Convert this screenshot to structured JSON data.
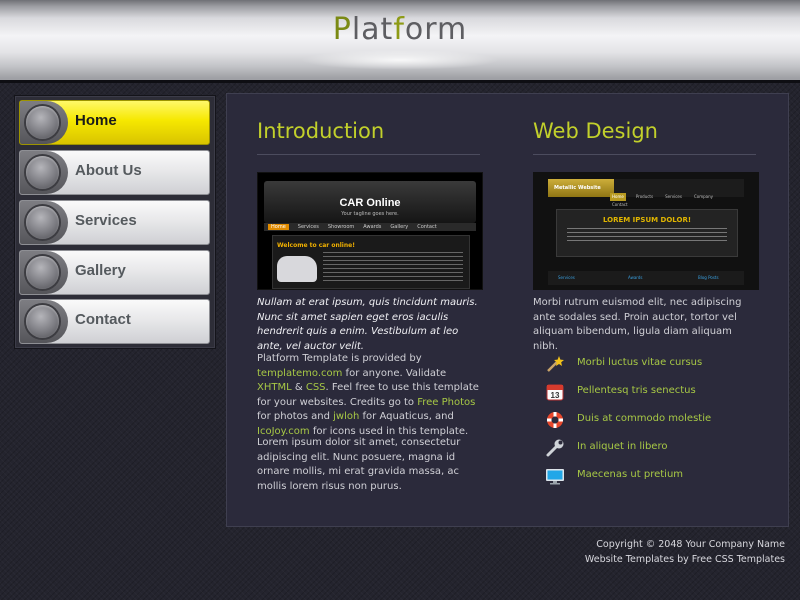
{
  "header": {
    "title_p": "P",
    "title_lat": "lat",
    "title_f": "f",
    "title_orm": "orm"
  },
  "nav": {
    "items": [
      {
        "label": "Home",
        "active": true
      },
      {
        "label": "About Us"
      },
      {
        "label": "Services"
      },
      {
        "label": "Gallery"
      },
      {
        "label": "Contact"
      }
    ]
  },
  "introduction": {
    "heading": "Introduction",
    "thumbnail": {
      "title": "CAR Online",
      "tagline": "Your tagline goes here.",
      "menu": [
        "Home",
        "Services",
        "Showroom",
        "Awards",
        "Gallery",
        "Contact"
      ],
      "welcome": "Welcome to car online!"
    },
    "intro_italic": "Nullam at erat ipsum, quis tincidunt mauris. Nunc sit amet sapien eget eros iaculis hendrerit quis a enim. Vestibulum at leo ante, vel auctor velit.",
    "credits": {
      "t1": "Platform Template is provided by ",
      "l1": "templatemo.com",
      "t2": " for anyone. Validate ",
      "l2": "XHTML",
      "t3": " & ",
      "l3": "CSS",
      "t4": ". Feel free to use this template for your websites. Credits go to ",
      "l4": "Free Photos",
      "t5": " for photos and ",
      "l5": "jwloh",
      "t6": " for Aquaticus, and ",
      "l6": "IcoJoy.com",
      "t7": " for icons used in this template."
    },
    "para3": "Lorem ipsum dolor sit amet, consectetur adipiscing elit. Nunc posuere, magna id ornare mollis, mi erat gravida massa, ac mollis lorem risus non purus."
  },
  "webdesign": {
    "heading": "Web Design",
    "thumbnail": {
      "logo": "Metallic Website",
      "menu": [
        "Home",
        "Products",
        "Services",
        "Company",
        "Contact"
      ],
      "panel_title": "LOREM IPSUM DOLOR!",
      "footer": [
        "Services",
        "Awards",
        "Blog Posts"
      ]
    },
    "description": "Morbi rutrum euismod elit, nec adipiscing ante sodales sed. Proin auctor, tortor vel aliquam bibendum, ligula diam aliquam nibh.",
    "features": [
      {
        "icon": "magic-wand-icon",
        "label": "Morbi luctus vitae cursus"
      },
      {
        "icon": "calendar-icon",
        "label": "Pellentesq tris senectus"
      },
      {
        "icon": "lifebuoy-icon",
        "label": "Duis at commodo molestie"
      },
      {
        "icon": "wrench-icon",
        "label": "In aliquet in libero"
      },
      {
        "icon": "monitor-icon",
        "label": "Maecenas ut pretium"
      }
    ],
    "calendar_day": "13"
  },
  "footer": {
    "line1": "Copyright © 2048 Your Company Name",
    "line2_prefix": "Website Templates",
    "line2_mid": " by ",
    "line2_suffix": "Free CSS Templates"
  },
  "colors": {
    "accent": "#c2d02b",
    "link": "#a7c845",
    "active_nav": "#f6e800",
    "background": "#24242e"
  }
}
